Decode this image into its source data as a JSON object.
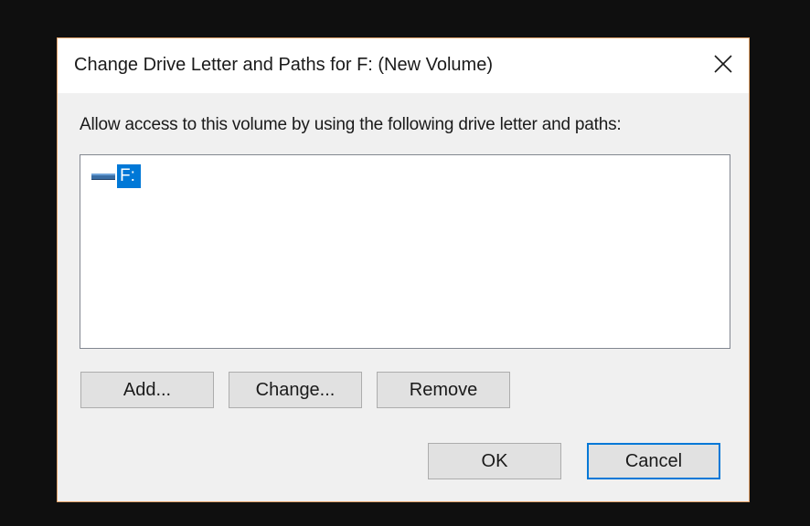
{
  "dialog": {
    "title": "Change Drive Letter and Paths for F: (New Volume)",
    "instruction": "Allow access to this volume by using the following drive letter and paths:",
    "list": {
      "items": [
        {
          "label": "F:",
          "icon": "drive-icon",
          "selected": true
        }
      ]
    },
    "buttons": {
      "add": "Add...",
      "change": "Change...",
      "remove": "Remove",
      "ok": "OK",
      "cancel": "Cancel"
    },
    "close_icon": "close-icon"
  },
  "colors": {
    "background": "#0f0f0f",
    "dialog_border": "#e3a36a",
    "selection": "#0078d7",
    "button_face": "#e1e1e1"
  }
}
